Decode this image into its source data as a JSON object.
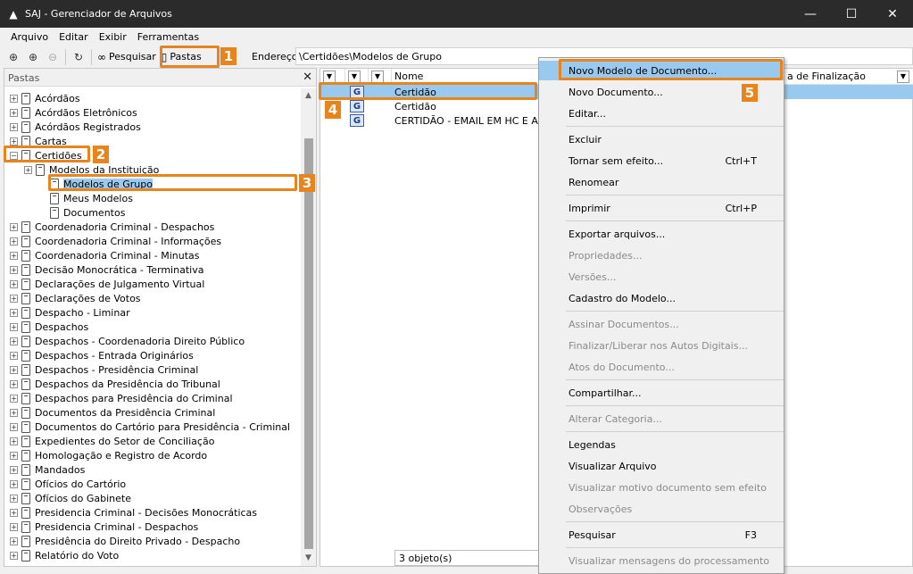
{
  "window": {
    "title": "SAJ - Gerenciador de Arquivos",
    "minimize": "—",
    "maximize": "☐",
    "close": "✕"
  },
  "menubar": [
    "Arquivo",
    "Editar",
    "Exibir",
    "Ferramentas"
  ],
  "toolbar": {
    "search_label": "Pesquisar",
    "folders_label": "Pastas",
    "address_label": "Endereço",
    "address_value": "\\Certidões\\Modelos de Grupo"
  },
  "left_panel": {
    "title": "Pastas",
    "close": "✕",
    "tree": [
      {
        "label": "Acórdãos"
      },
      {
        "label": "Acórdãos Eletrônicos"
      },
      {
        "label": "Acórdãos Registrados"
      },
      {
        "label": "Cartas"
      },
      {
        "label": "Certidões"
      },
      {
        "label": "Modelos da Instituição"
      },
      {
        "label": "Modelos de Grupo"
      },
      {
        "label": "Meus Modelos"
      },
      {
        "label": "Documentos"
      },
      {
        "label": "Coordenadoria Criminal - Despachos"
      },
      {
        "label": "Coordenadoria Criminal - Informações"
      },
      {
        "label": "Coordenadoria Criminal - Minutas"
      },
      {
        "label": "Decisão Monocrática - Terminativa"
      },
      {
        "label": "Declarações de Julgamento Virtual"
      },
      {
        "label": "Declarações de Votos"
      },
      {
        "label": "Despacho - Liminar"
      },
      {
        "label": "Despachos"
      },
      {
        "label": "Despachos - Coordenadoria Direito Público"
      },
      {
        "label": "Despachos - Entrada Originários"
      },
      {
        "label": "Despachos - Presidência Criminal"
      },
      {
        "label": "Despachos da Presidência do Tribunal"
      },
      {
        "label": "Despachos para Presidência do Criminal"
      },
      {
        "label": "Documentos da Presidência Criminal"
      },
      {
        "label": "Documentos do Cartório para Presidência - Criminal"
      },
      {
        "label": "Expedientes do Setor de Conciliação"
      },
      {
        "label": "Homologação e Registro de Acordo"
      },
      {
        "label": "Mandados"
      },
      {
        "label": "Ofícios do Cartório"
      },
      {
        "label": "Ofícios do Gabinete"
      },
      {
        "label": "Presidencia Criminal - Decisões Monocráticas"
      },
      {
        "label": "Presidencia Criminal - Despachos"
      },
      {
        "label": "Presidência do Direito Privado - Despacho"
      },
      {
        "label": "Relatório do Voto"
      }
    ]
  },
  "list": {
    "col_name": "Nome",
    "col_finalization": "a de Finalização",
    "rows": [
      "Certidão",
      "Certidão",
      "CERTIDÃO - EMAIL EM HC E AGI"
    ],
    "status": "3 objeto(s)"
  },
  "context_menu": [
    {
      "label": "Novo Modelo de Documento...",
      "shortcut": ""
    },
    {
      "label": "Novo Documento...",
      "shortcut": ""
    },
    {
      "label": "Editar...",
      "shortcut": ""
    },
    {
      "label": "Excluir",
      "shortcut": ""
    },
    {
      "label": "Tornar sem efeito...",
      "shortcut": "Ctrl+T"
    },
    {
      "label": "Renomear",
      "shortcut": ""
    },
    {
      "label": "Imprimir",
      "shortcut": "Ctrl+P"
    },
    {
      "label": "Exportar arquivos...",
      "shortcut": ""
    },
    {
      "label": "Propriedades...",
      "shortcut": ""
    },
    {
      "label": "Versões...",
      "shortcut": ""
    },
    {
      "label": "Cadastro do Modelo...",
      "shortcut": ""
    },
    {
      "label": "Assinar Documentos...",
      "shortcut": ""
    },
    {
      "label": "Finalizar/Liberar nos Autos Digitais...",
      "shortcut": ""
    },
    {
      "label": "Atos do Documento...",
      "shortcut": ""
    },
    {
      "label": "Compartilhar...",
      "shortcut": ""
    },
    {
      "label": "Alterar Categoria...",
      "shortcut": ""
    },
    {
      "label": "Legendas",
      "shortcut": ""
    },
    {
      "label": "Visualizar Arquivo",
      "shortcut": ""
    },
    {
      "label": "Visualizar motivo documento sem efeito",
      "shortcut": ""
    },
    {
      "label": "Observações",
      "shortcut": ""
    },
    {
      "label": "Pesquisar",
      "shortcut": "F3"
    },
    {
      "label": "Visualizar mensagens do processamento",
      "shortcut": ""
    }
  ],
  "callouts": [
    "1",
    "2",
    "3",
    "4",
    "5"
  ],
  "colors": {
    "callout": "#e8841d",
    "selection": "#99c9ef",
    "titlebar": "#2b2b2b"
  }
}
